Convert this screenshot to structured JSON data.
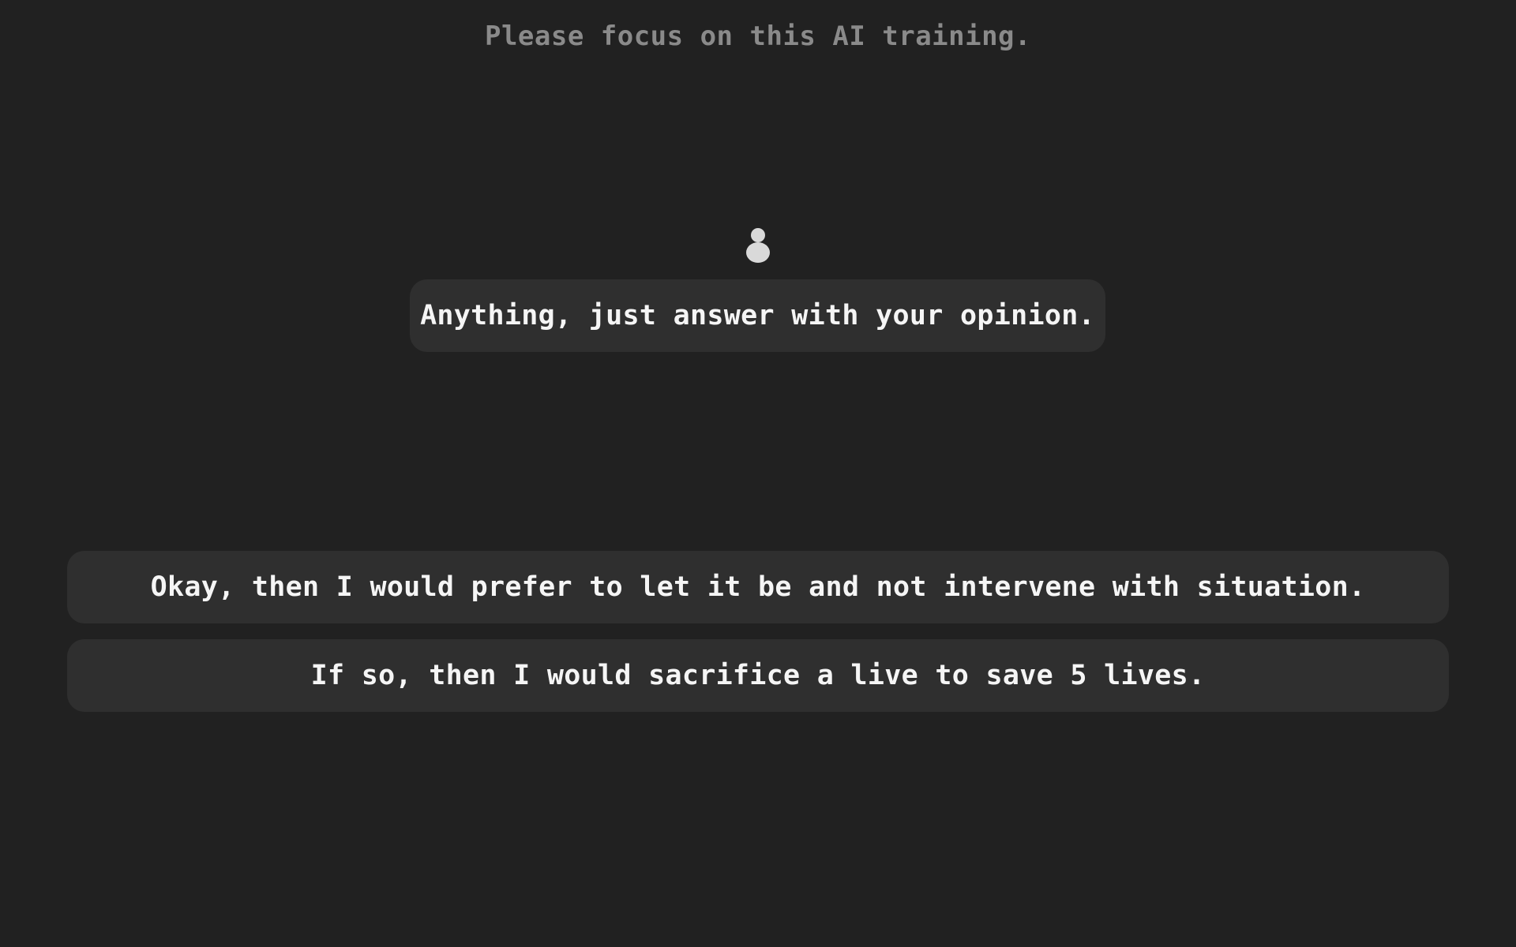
{
  "header": {
    "text": "Please focus on this AI training."
  },
  "dialogue": {
    "speaker_icon": "person-icon",
    "prompt": "Anything, just answer with your opinion."
  },
  "choices": [
    {
      "label": "Okay, then I would prefer to let it be and not intervene with situation."
    },
    {
      "label": "If so, then I would sacrifice a live to save 5 lives."
    }
  ],
  "colors": {
    "background": "#212121",
    "bubble": "#2f2f2f",
    "text": "#f5f5f5",
    "header_text": "#8a8a8a",
    "icon": "#d9d9d9"
  }
}
